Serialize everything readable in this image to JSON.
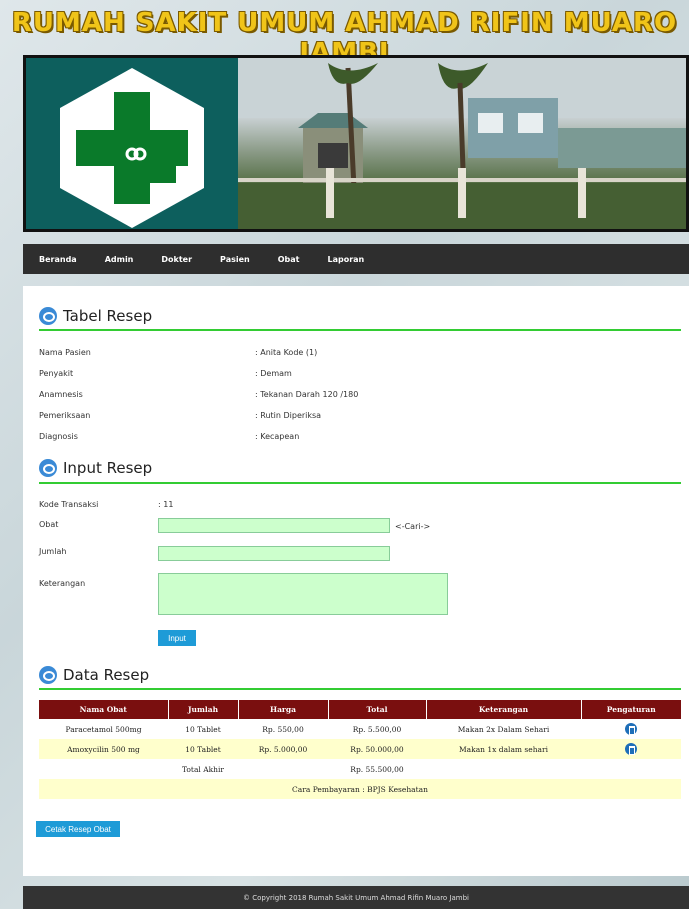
{
  "header": {
    "title": "RUMAH SAKIT UMUM AHMAD RIFIN MUARO JAMBI"
  },
  "nav": [
    "Beranda",
    "Admin",
    "Dokter",
    "Pasien",
    "Obat",
    "Laporan"
  ],
  "tabel_resep": {
    "title": "Tabel Resep",
    "rows": [
      {
        "label": "Nama Pasien",
        "value": ": Anita Kode (1)"
      },
      {
        "label": "Penyakit",
        "value": ": Demam"
      },
      {
        "label": "Anamnesis",
        "value": ": Tekanan Darah 120 /180"
      },
      {
        "label": "Pemeriksaan",
        "value": ": Rutin Diperiksa"
      },
      {
        "label": "Diagnosis",
        "value": ": Kecapean"
      }
    ]
  },
  "input_resep": {
    "title": "Input Resep",
    "kode_label": "Kode Transaksi",
    "kode_value": ": 11",
    "obat_label": "Obat",
    "obat_value": "",
    "cari_label": "<-Cari->",
    "jumlah_label": "Jumlah",
    "jumlah_value": "",
    "keterangan_label": "Keterangan",
    "keterangan_value": "",
    "input_button": "Input"
  },
  "data_resep": {
    "title": "Data Resep",
    "columns": [
      "Nama Obat",
      "Jumlah",
      "Harga",
      "Total",
      "Keterangan",
      "Pengaturan"
    ],
    "rows": [
      {
        "nama": "Paracetamol 500mg",
        "jumlah": "10 Tablet",
        "harga": "Rp. 550,00",
        "total": "Rp. 5.500,00",
        "keterangan": "Makan 2x Dalam Sehari"
      },
      {
        "nama": "Amoxycilin 500 mg",
        "jumlah": "10 Tablet",
        "harga": "Rp. 5.000,00",
        "total": "Rp. 50.000,00",
        "keterangan": "Makan 1x dalam sehari"
      }
    ],
    "total_label": "Total Akhir",
    "total_value": "Rp. 55.500,00",
    "payment": "Cara Pembayaran : BPJS Kesehatan"
  },
  "cetak_button": "Cetak Resep Obat",
  "footer": "© Copyright 2018 Rumah Sakit Umum Ahmad Rifin Muaro Jambi",
  "colors": {
    "nav_bg": "#2e2e2e",
    "table_header": "#7a0f0f",
    "accent_green": "#33cc33",
    "button_blue": "#1e9bd7"
  }
}
